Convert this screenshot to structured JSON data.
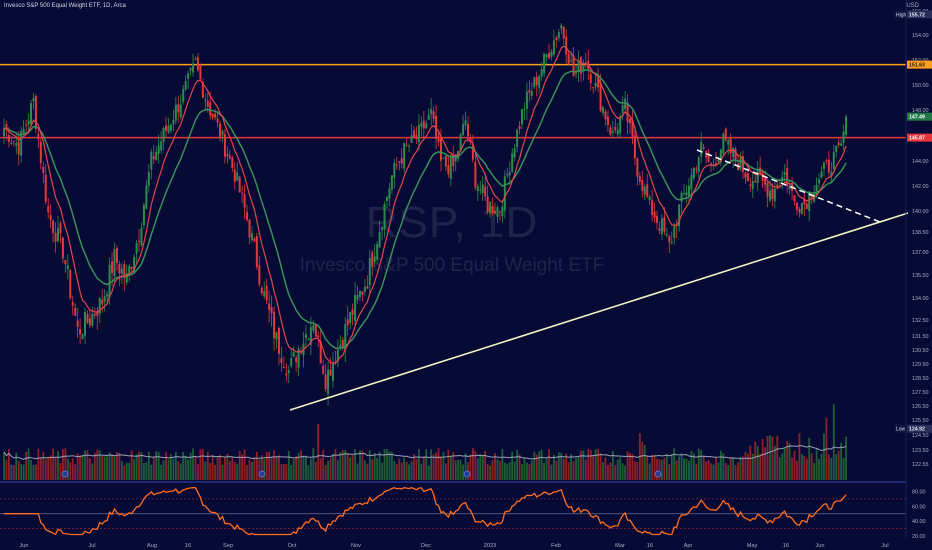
{
  "header": {
    "title": "Invesco S&P 500 Equal Weight ETF, 1D, Arca",
    "currency": "USD"
  },
  "watermark": {
    "symbol": "RSP, 1D",
    "name": "Invesco S&P 500 Equal Weight ETF"
  },
  "colors": {
    "background": "#060a35",
    "up": "#2e8b4e",
    "down": "#e0393e",
    "ema_fast": "#e04848",
    "ema_slow": "#3a8f5a",
    "orange_line": "#ff9f1c",
    "red_line": "#e8343c",
    "trendline": "#f2f3c2",
    "rsi": "#ff6d1f",
    "volume_ma": "#9aa0b4"
  },
  "chart_data": [
    {
      "type": "candlestick",
      "title": "Invesco S&P 500 Equal Weight ETF, 1D, Arca",
      "ylim": [
        122.55,
        158.5
      ],
      "y_ticks": [
        "156.00",
        "154.00",
        "152.00",
        "150.00",
        "148.00",
        "146.00",
        "144.00",
        "142.00",
        "140.00",
        "138.50",
        "137.00",
        "135.50",
        "134.00",
        "132.50",
        "131.50",
        "130.50",
        "129.50",
        "128.50",
        "127.50",
        "126.50",
        "125.50",
        "124.50",
        "123.50",
        "122.55"
      ],
      "x_ticks": [
        "Jun",
        "Jul",
        "Aug",
        "16",
        "Sep",
        "Oct",
        "Nov",
        "Dec",
        "2023",
        "Feb",
        "Mar",
        "16",
        "Apr",
        "May",
        "16",
        "Jun",
        "Jul"
      ],
      "labels": {
        "high_label": "High",
        "high_value": "155.72",
        "orange_level": "151.63",
        "last_price": "147.49",
        "red_level": "145.87",
        "low_label": "Low",
        "low_value": "124.92"
      },
      "levels": {
        "high": 155.72,
        "orange": 151.63,
        "last": 147.49,
        "red": 145.87,
        "low": 124.92
      },
      "close_anchors": [
        [
          0,
          146.6
        ],
        [
          6,
          145.2
        ],
        [
          12,
          148.7
        ],
        [
          18,
          139.8
        ],
        [
          24,
          137.2
        ],
        [
          30,
          131.8
        ],
        [
          35,
          132.6
        ],
        [
          40,
          133.8
        ],
        [
          45,
          136.6
        ],
        [
          50,
          135.2
        ],
        [
          55,
          138.4
        ],
        [
          60,
          144.0
        ],
        [
          66,
          146.5
        ],
        [
          72,
          148.8
        ],
        [
          78,
          151.6
        ],
        [
          83,
          148.5
        ],
        [
          88,
          146.2
        ],
        [
          94,
          143.0
        ],
        [
          100,
          138.7
        ],
        [
          106,
          134.1
        ],
        [
          111,
          131.2
        ],
        [
          116,
          129.0
        ],
        [
          121,
          131.0
        ],
        [
          126,
          132.6
        ],
        [
          131,
          128.5
        ],
        [
          137,
          131.0
        ],
        [
          143,
          133.5
        ],
        [
          148,
          135.3
        ],
        [
          153,
          138.8
        ],
        [
          158,
          142.8
        ],
        [
          163,
          144.8
        ],
        [
          168,
          145.8
        ],
        [
          174,
          147.6
        ],
        [
          178,
          143.8
        ],
        [
          183,
          143.5
        ],
        [
          188,
          147.2
        ],
        [
          192,
          142.6
        ],
        [
          197,
          140.5
        ],
        [
          202,
          140.2
        ],
        [
          207,
          144.8
        ],
        [
          212,
          148.4
        ],
        [
          217,
          150.5
        ],
        [
          222,
          152.8
        ],
        [
          227,
          154.8
        ],
        [
          232,
          150.8
        ],
        [
          237,
          152.0
        ],
        [
          243,
          148.7
        ],
        [
          248,
          146.0
        ],
        [
          253,
          148.2
        ],
        [
          258,
          143.4
        ],
        [
          263,
          140.4
        ],
        [
          268,
          138.8
        ],
        [
          271,
          137.4
        ],
        [
          275,
          140.2
        ],
        [
          280,
          142.8
        ],
        [
          284,
          145.0
        ],
        [
          288,
          143.5
        ],
        [
          293,
          145.5
        ],
        [
          298,
          144.2
        ],
        [
          303,
          142.8
        ],
        [
          308,
          142.4
        ],
        [
          313,
          141.5
        ],
        [
          318,
          143.0
        ],
        [
          322,
          140.8
        ],
        [
          326,
          140.6
        ],
        [
          331,
          142.4
        ],
        [
          336,
          143.6
        ],
        [
          341,
          145.0
        ],
        [
          343,
          147.49
        ]
      ],
      "first_date": "2022-05-24",
      "last_date": "2023-06-23",
      "series": [
        {
          "name": "",
          "kind": "EMA fast"
        },
        {
          "name": "",
          "kind": "EMA slow"
        }
      ]
    },
    {
      "type": "bar",
      "title": "",
      "series": [
        {
          "name": "",
          "kind": "volume"
        },
        {
          "name": "",
          "kind": "volume moving average"
        }
      ]
    },
    {
      "type": "line",
      "title": "",
      "ylim": [
        20,
        90
      ],
      "y_ticks": [
        "80.00",
        "60.00",
        "40.00",
        "20.00"
      ],
      "reference_levels": [
        70,
        50,
        30
      ],
      "series": [
        {
          "name": "",
          "kind": "RSI"
        }
      ]
    }
  ]
}
